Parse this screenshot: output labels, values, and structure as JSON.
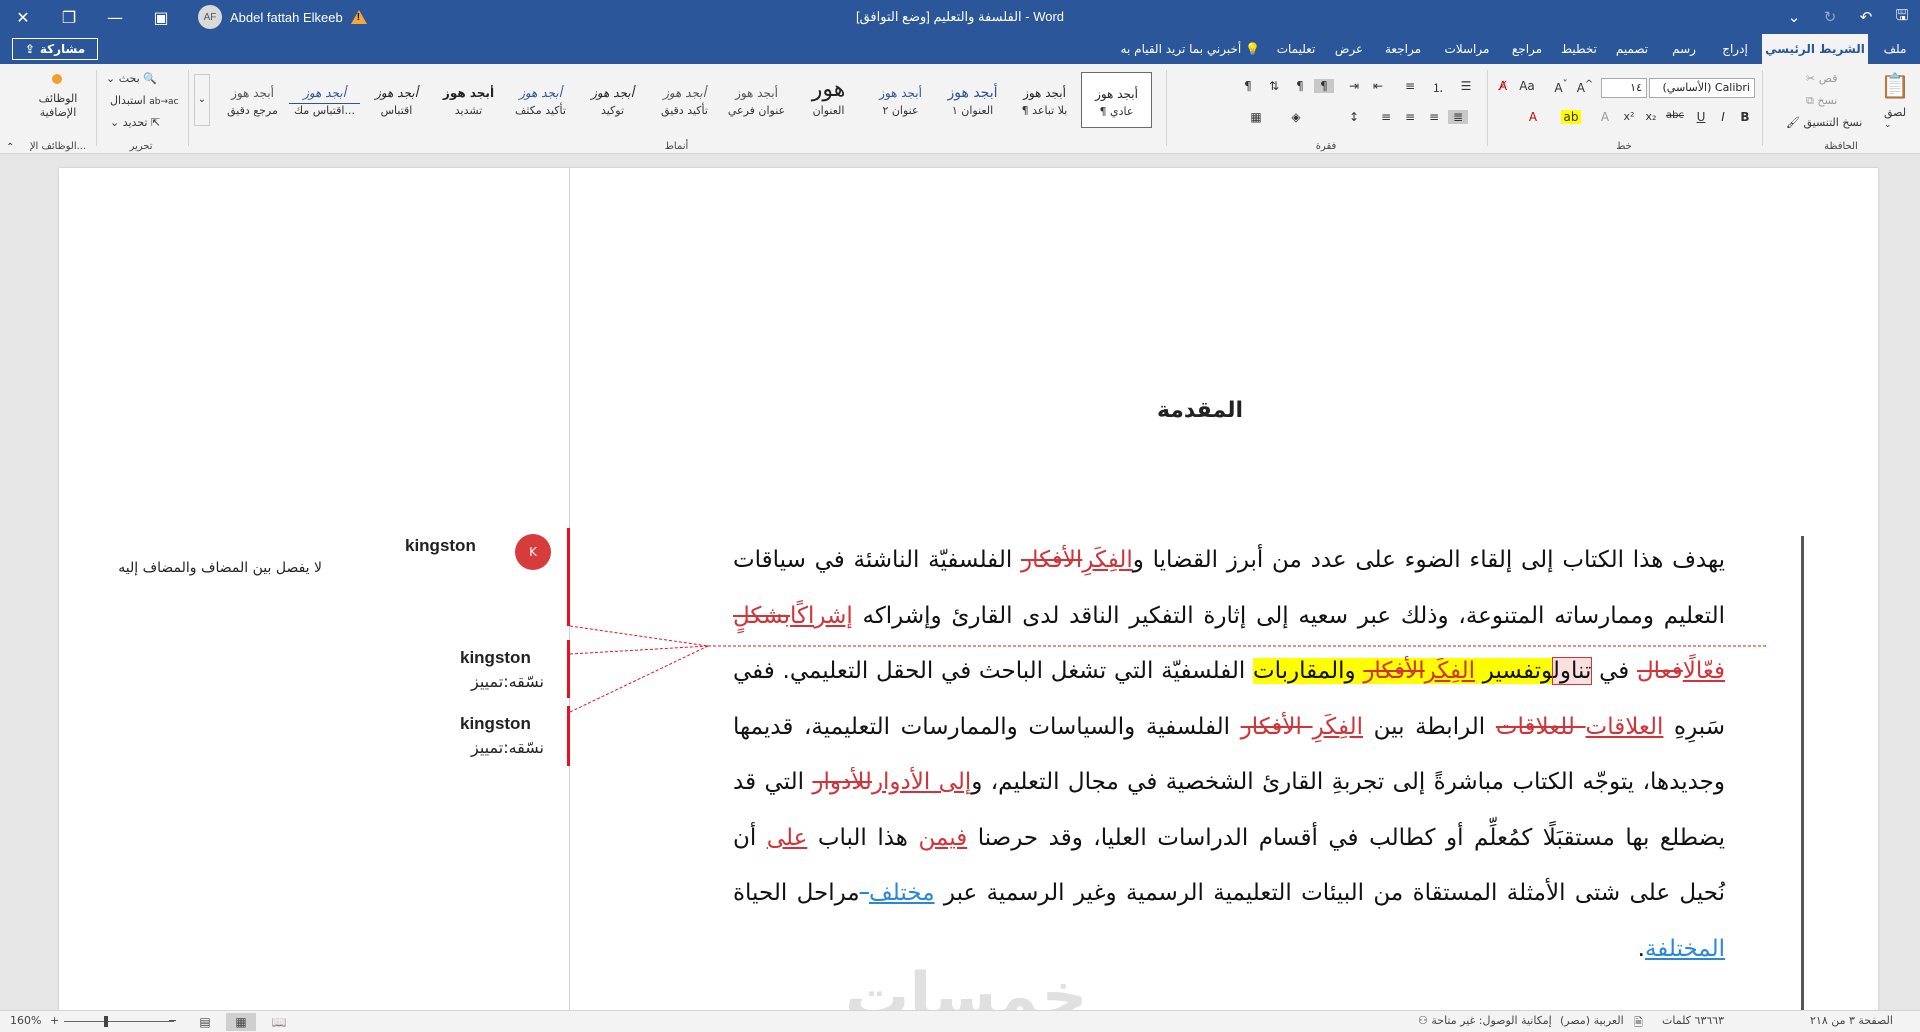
{
  "window": {
    "title": "الفلسفة والتعليم [وضع التوافق]  -  Word",
    "user_name": "Abdel fattah Elkeeb",
    "user_initials": "AF"
  },
  "tabs": {
    "file": "ملف",
    "home": "الشريط الرئيسي",
    "insert": "إدراج",
    "draw": "رسم",
    "design": "تصميم",
    "layout": "تخطيط",
    "references": "مراجع",
    "mailings": "مراسلات",
    "review": "مراجعة",
    "view": "عرض",
    "help": "تعليمات",
    "tell_me": "أخبرني بما تريد القيام به",
    "share": "مشاركة"
  },
  "ribbon": {
    "clipboard": {
      "label": "الحافظة",
      "paste": "لصق",
      "cut": "قص",
      "copy": "نسخ",
      "format_painter": "نسخ التنسيق"
    },
    "font": {
      "label": "خط",
      "font_name": "Calibri (الأساسي)",
      "font_size": "١٤"
    },
    "paragraph": {
      "label": "فقرة"
    },
    "styles": {
      "label": "أنماط",
      "items": [
        {
          "sample": "أبجد هوز",
          "name": "¶ عادي"
        },
        {
          "sample": "أبجد هوز",
          "name": "¶ بلا تباعد"
        },
        {
          "sample": "أبجد هوز",
          "name": "العنوان ١"
        },
        {
          "sample": "أبجد هوز",
          "name": "عنوان ٢"
        },
        {
          "sample": "هور",
          "name": "العنوان"
        },
        {
          "sample": "أبجد هوز",
          "name": "عنوان فرعي"
        },
        {
          "sample": "أبجد هوز",
          "name": "تأكيد دقيق"
        },
        {
          "sample": "أبجد هوز",
          "name": "توكيد"
        },
        {
          "sample": "أبجد هوز",
          "name": "تأكيد مكثف"
        },
        {
          "sample": "أبجد هوز",
          "name": "تشديد"
        },
        {
          "sample": "أبجد هوز",
          "name": "اقتباس"
        },
        {
          "sample": "أبجد هوز",
          "name": "اقتباس مك..."
        },
        {
          "sample": "أبجد هوز",
          "name": "مرجع دقيق"
        }
      ]
    },
    "editing": {
      "label": "تحرير",
      "find": "بحث",
      "replace": "استبدال",
      "select": "تحديد"
    },
    "addins": {
      "label": "الوظائف الإ...",
      "button": "الوظائف الإضافية"
    }
  },
  "document": {
    "heading": "المقدمة",
    "paragraph": [
      {
        "t": "n",
        "v": "يهدف هذا الكتاب إلى إلقاء الضوء على عدد من أبرز القضايا و"
      },
      {
        "t": "ins",
        "v": "الفِكَرِ"
      },
      {
        "t": "del",
        "v": "الأفكار"
      },
      {
        "t": "n",
        "v": " الفلسفيّة الناشئة في سياقات التعليم وممارساته المتنوعة، وذلك عبر سعيه إلى إثارة التفكير الناقد لدى القارئ وإشراكه "
      },
      {
        "t": "ins",
        "v": "إشراكًا"
      },
      {
        "t": "del",
        "v": "بشكلٍ"
      },
      {
        "t": "n",
        "v": " "
      },
      {
        "t": "ins",
        "v": "فعّالًا"
      },
      {
        "t": "del",
        "v": "فعال"
      },
      {
        "t": "n",
        "v": " في "
      },
      {
        "t": "box",
        "v": "تناول"
      },
      {
        "t": "hl",
        "v": "وتفسير "
      },
      {
        "t": "hlins",
        "v": "الفِكَر"
      },
      {
        "t": "hldel",
        "v": "الأفكار"
      },
      {
        "t": "hl",
        "v": " والمقاربات"
      },
      {
        "t": "n",
        "v": " الفلسفيّة التي تشغل الباحث في الحقل التعليمي. ففي سَبرِهِ "
      },
      {
        "t": "ins",
        "v": "العلاقات"
      },
      {
        "t": "del",
        "v": " للعلاقات"
      },
      {
        "t": "n",
        "v": " الرابطة بين "
      },
      {
        "t": "ins",
        "v": "الفِكَرِ"
      },
      {
        "t": "del",
        "v": " الأفكار"
      },
      {
        "t": "n",
        "v": " الفلسفية والسياسات والممارسات التعليمية، قديمها وجديدها، يتوجّه الكتاب مباشرةً إلى تجربةِ القارئ الشخصية في مجال التعليم، و"
      },
      {
        "t": "ins",
        "v": "إلى الأدوار"
      },
      {
        "t": "del",
        "v": "للأدوار"
      },
      {
        "t": "n",
        "v": " التي قد يضطلع بها مستقبَلًا كمُعلِّم أو كطالب في أقسام الدراسات العليا، وقد حرصنا "
      },
      {
        "t": "ins",
        "v": "فيمن"
      },
      {
        "t": "n",
        "v": " هذا الباب "
      },
      {
        "t": "ins",
        "v": "على"
      },
      {
        "t": "n",
        "v": " أن نُحيل على شتى الأمثلة المستقاة من البيئات التعليمية الرسمية وغير الرسمية عبر "
      },
      {
        "t": "insb",
        "v": "مختلف"
      },
      {
        "t": "delb",
        "v": " "
      },
      {
        "t": "n",
        "v": "مراحل الحياة "
      },
      {
        "t": "insb",
        "v": "المختلفة"
      },
      {
        "t": "n",
        "v": "."
      }
    ]
  },
  "comments": [
    {
      "author": "kingston",
      "initial": "K",
      "body": "لا يفصل بين المضاف والمضاف إليه"
    },
    {
      "author": "kingston",
      "body": "نسّقه:تمييز"
    },
    {
      "author": "kingston",
      "body": "نسّقه:تمييز"
    }
  ],
  "watermark": "خمسات",
  "statusbar": {
    "page": "الصفحة ٣ من ٢١٨",
    "words": "٦٣٦٦٣ كلمات",
    "language": "العربية (مصر)",
    "accessibility": "إمكانية الوصول: غير متاحة",
    "zoom": "160%"
  },
  "colors": {
    "accent": "#2b579a",
    "insertion": "#d13438",
    "move": "#2b88d8",
    "highlight": "#ffff00",
    "comment": "#e81123"
  }
}
